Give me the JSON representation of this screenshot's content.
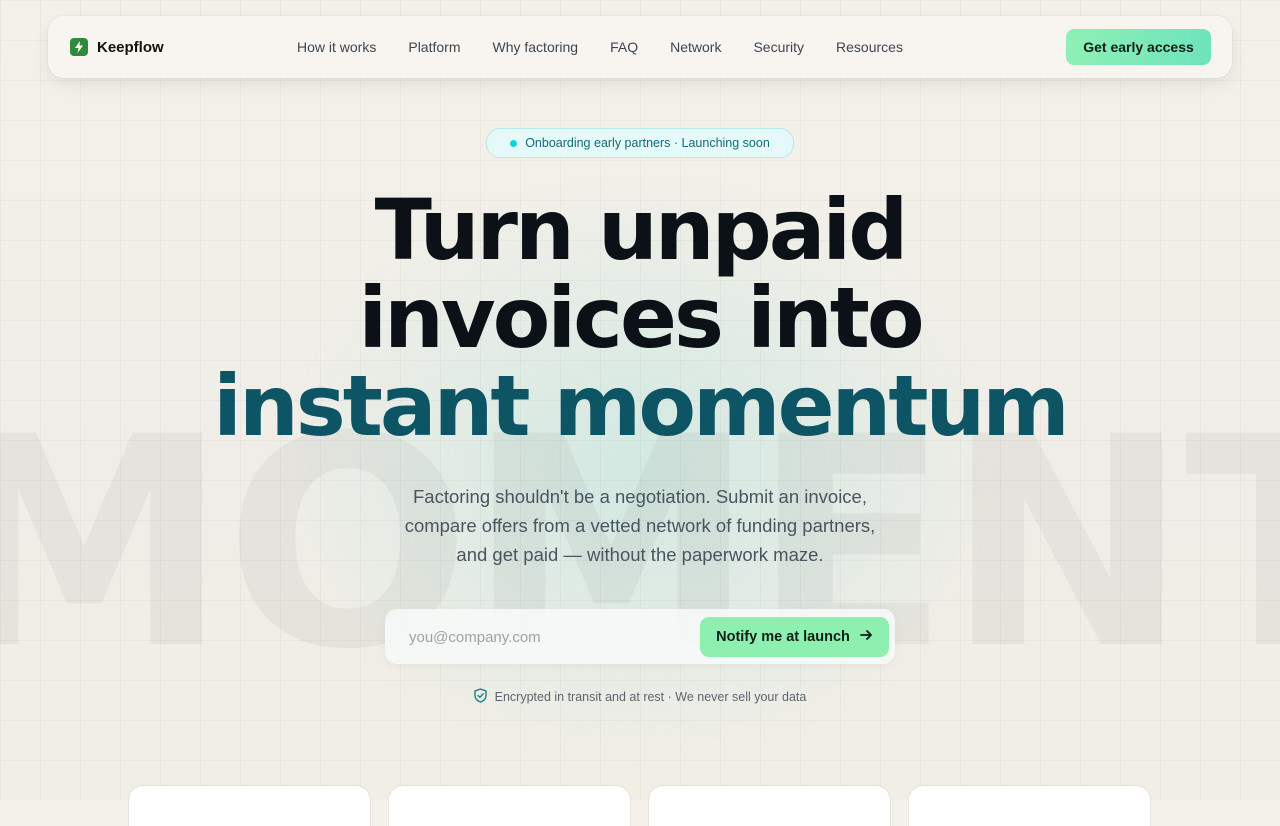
{
  "brand": {
    "name": "Keepflow",
    "icon": "bolt-icon",
    "color": "#2f8a3d"
  },
  "nav": {
    "links": [
      "How it works",
      "Platform",
      "Why factoring",
      "FAQ",
      "Network",
      "Security",
      "Resources"
    ],
    "cta_label": "Get early access"
  },
  "hero": {
    "badge": "Onboarding early partners · Launching soon",
    "headline_line1": "Turn unpaid",
    "headline_line2": "invoices into",
    "headline_accent": "instant momentum",
    "background_word": "MOMENTUM",
    "subtitle": "Factoring shouldn't be a negotiation. Submit an invoice, compare offers from a vetted network of funding partners, and get paid — without the paperwork maze."
  },
  "signup": {
    "email_placeholder": "you@company.com",
    "email_value": "",
    "button_label": "Notify me at launch",
    "button_icon": "arrow-right-icon"
  },
  "trust": {
    "icon": "shield-check-icon",
    "text": "Encrypted in transit and at rest · We never sell your data"
  },
  "colors": {
    "accent_green": "#8ef0b0",
    "headline_accent": "#0d5565",
    "badge_dot": "#12d1e0"
  }
}
